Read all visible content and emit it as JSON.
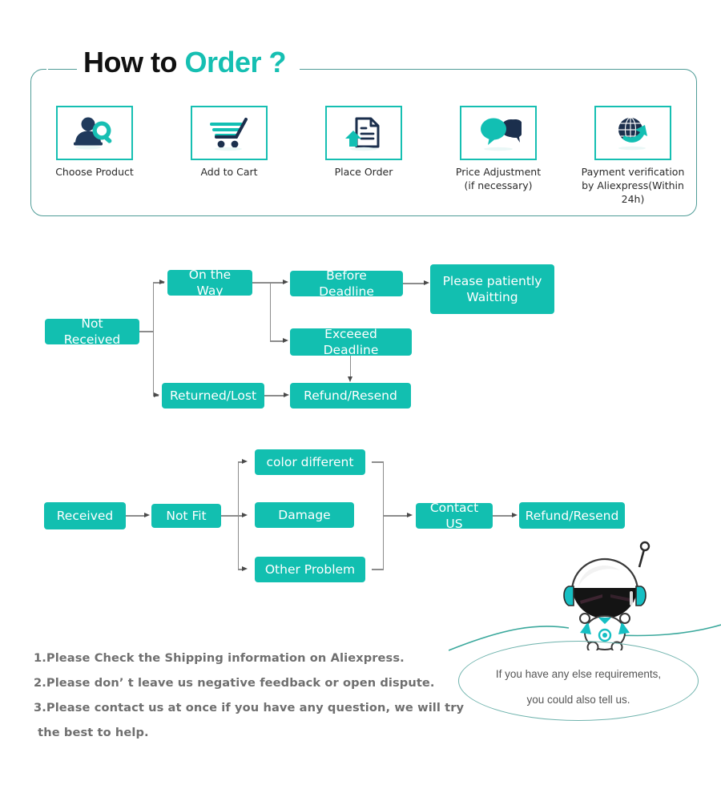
{
  "header": {
    "title_part1": "How to",
    "title_part2": "Order ?",
    "accent_color": "#16bfb2",
    "frame_color": "#4f9c97",
    "steps": [
      {
        "icon": "person-search-icon",
        "label_line1": "Choose  Product",
        "label_line2": ""
      },
      {
        "icon": "shopping-cart-icon",
        "label_line1": "Add to Cart",
        "label_line2": ""
      },
      {
        "icon": "document-upload-icon",
        "label_line1": "Place  Order",
        "label_line2": ""
      },
      {
        "icon": "speech-bubbles-icon",
        "label_line1": "Price Adjustment",
        "label_line2": "(if necessary)"
      },
      {
        "icon": "globe-arrow-icon",
        "label_line1": "Payment verification",
        "label_line2": "by Aliexpress(Within 24h)"
      }
    ]
  },
  "flow_not_received": {
    "box_color": "#12bfb0",
    "connector_color": "#8c8c8c",
    "nodes": {
      "root": "Not Received",
      "on_the_way": "On the Way",
      "returned_lost": "Returned/Lost",
      "before_deadline": "Before Deadline",
      "exceed_deadline": "Exceeed Deadline",
      "refund_resend": "Refund/Resend",
      "please_wait_line1": "Please patiently",
      "please_wait_line2": "Waitting"
    }
  },
  "flow_received": {
    "box_color": "#12bfb0",
    "nodes": {
      "root": "Received",
      "not_fit": "Not Fit",
      "color_different": "color different",
      "damage": "Damage",
      "other_problem": "Other Problem",
      "contact_us": "Contact US",
      "refund_resend": "Refund/Resend"
    }
  },
  "notes": [
    "1.Please Check the Shipping information on Aliexpress.",
    "2.Please don’ t leave us negative feedback or open dispute.",
    "3.Please contact us at once if you have any question, we will try",
    " the best to help."
  ],
  "bubble": {
    "line1": "If you have any else requirements,",
    "line2": "you could also tell us.",
    "outline_color": "#6fb3ad"
  },
  "mascot": {
    "name": "astronaut-mascot"
  }
}
